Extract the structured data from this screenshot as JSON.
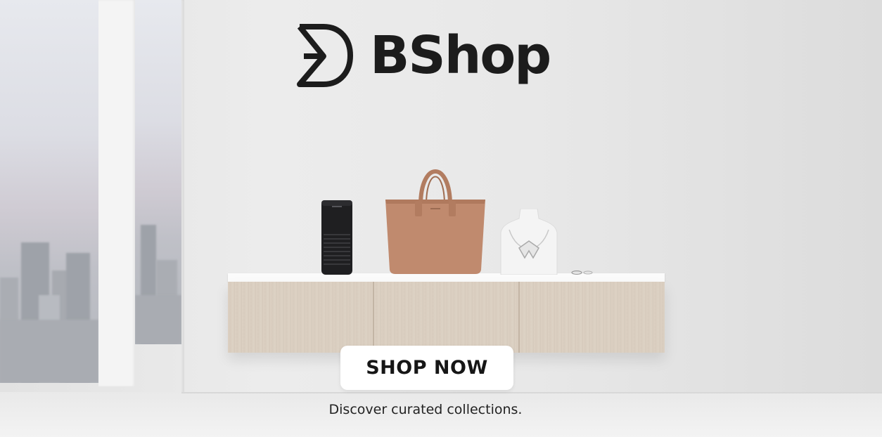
{
  "brand": {
    "name": "BShop",
    "logo_icon": "bshop-monogram-icon",
    "color": "#1c1c1c"
  },
  "hero": {
    "cta_label": "SHOP NOW",
    "tagline": "Discover curated collections."
  },
  "products": [
    {
      "icon": "speaker-icon"
    },
    {
      "icon": "tote-bag-icon"
    },
    {
      "icon": "necklace-bust-icon"
    },
    {
      "icon": "ring-icon"
    }
  ],
  "colors": {
    "cta_background": "#ffffff",
    "cta_text": "#161616",
    "bag": "#c08a6e",
    "speaker": "#1f1f21",
    "shelf_wood": "#dbcfc1"
  }
}
